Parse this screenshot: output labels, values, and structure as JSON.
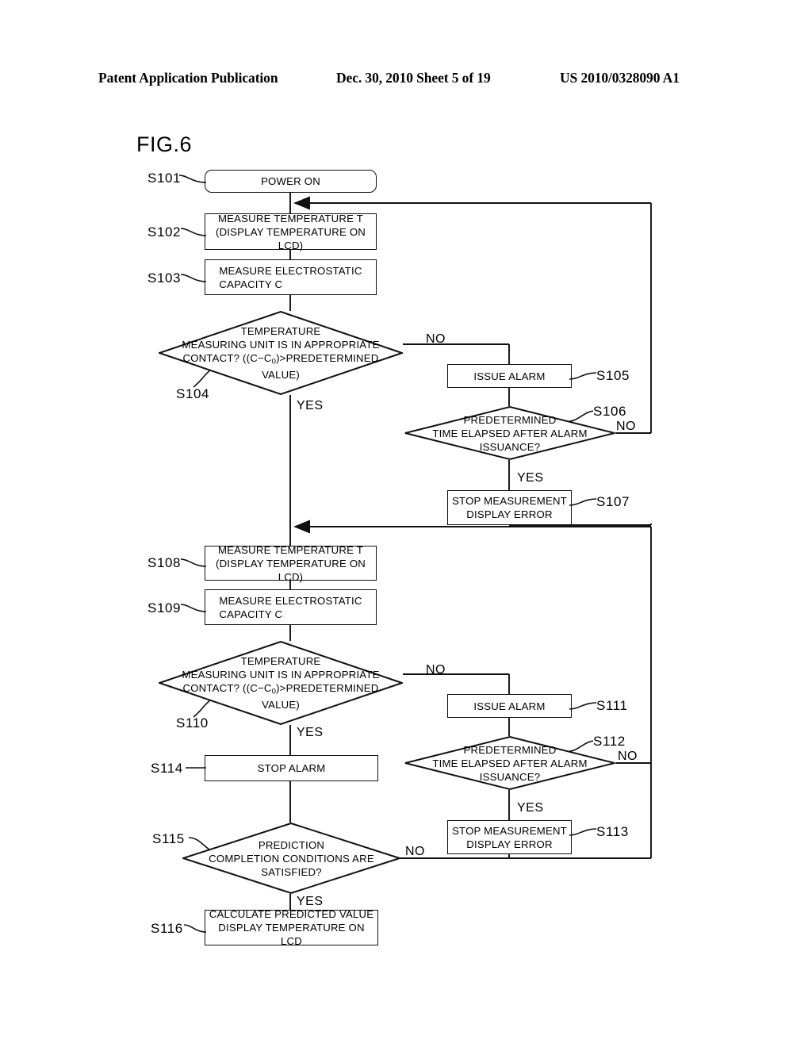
{
  "header": {
    "publication": "Patent Application Publication",
    "date_sheet": "Dec. 30, 2010  Sheet 5 of 19",
    "patent_number": "US 2010/0328090 A1"
  },
  "figure": {
    "label": "FIG.6"
  },
  "flowchart": {
    "nodes": [
      {
        "id": "S101",
        "step": "S101",
        "shape": "terminator",
        "text": "POWER ON"
      },
      {
        "id": "S102",
        "step": "S102",
        "shape": "process",
        "line1": "MEASURE TEMPERATURE T",
        "line2": "(DISPLAY TEMPERATURE ON LCD)"
      },
      {
        "id": "S103",
        "step": "S103",
        "shape": "process",
        "line1": "MEASURE ELECTROSTATIC",
        "line2": "CAPACITY C"
      },
      {
        "id": "S104",
        "step": "S104",
        "shape": "decision",
        "line1": "TEMPERATURE",
        "line2": "MEASURING UNIT IS IN APPROPRIATE",
        "line3_a": "CONTACT? ((C−C",
        "line3_sub": "0",
        "line3_b": ")>PREDETERMINED",
        "line4": "VALUE)",
        "yes": "YES",
        "no": "NO"
      },
      {
        "id": "S105",
        "step": "S105",
        "shape": "process",
        "text": "ISSUE ALARM"
      },
      {
        "id": "S106",
        "step": "S106",
        "shape": "decision",
        "line1": "PREDETERMINED",
        "line2": "TIME ELAPSED AFTER ALARM",
        "line3": "ISSUANCE?",
        "yes": "YES",
        "no": "NO"
      },
      {
        "id": "S107",
        "step": "S107",
        "shape": "process",
        "line1": "STOP MEASUREMENT",
        "line2": "DISPLAY ERROR"
      },
      {
        "id": "S108",
        "step": "S108",
        "shape": "process",
        "line1": "MEASURE TEMPERATURE T",
        "line2": "(DISPLAY TEMPERATURE ON LCD)"
      },
      {
        "id": "S109",
        "step": "S109",
        "shape": "process",
        "line1": "MEASURE ELECTROSTATIC",
        "line2": "CAPACITY C"
      },
      {
        "id": "S110",
        "step": "S110",
        "shape": "decision",
        "line1": "TEMPERATURE",
        "line2": "MEASURING UNIT IS IN APPROPRIATE",
        "line3_a": "CONTACT? ((C−C",
        "line3_sub": "0",
        "line3_b": ")>PREDETERMINED",
        "line4": "VALUE)",
        "yes": "YES",
        "no": "NO"
      },
      {
        "id": "S111",
        "step": "S111",
        "shape": "process",
        "text": "ISSUE ALARM"
      },
      {
        "id": "S112",
        "step": "S112",
        "shape": "decision",
        "line1": "PREDETERMINED",
        "line2": "TIME ELAPSED AFTER ALARM",
        "line3": "ISSUANCE?",
        "yes": "YES",
        "no": "NO"
      },
      {
        "id": "S113",
        "step": "S113",
        "shape": "process",
        "line1": "STOP MEASUREMENT",
        "line2": "DISPLAY ERROR"
      },
      {
        "id": "S114",
        "step": "S114",
        "shape": "process",
        "text": "STOP ALARM"
      },
      {
        "id": "S115",
        "step": "S115",
        "shape": "decision",
        "line1": "PREDICTION",
        "line2": "COMPLETION CONDITIONS ARE",
        "line3": "SATISFIED?",
        "yes": "YES",
        "no": "NO"
      },
      {
        "id": "S116",
        "step": "S116",
        "shape": "process",
        "line1": "CALCULATE PREDICTED VALUE",
        "line2": "DISPLAY TEMPERATURE ON LCD"
      }
    ]
  },
  "colors": {
    "ink": "#111111",
    "paper": "#ffffff"
  }
}
